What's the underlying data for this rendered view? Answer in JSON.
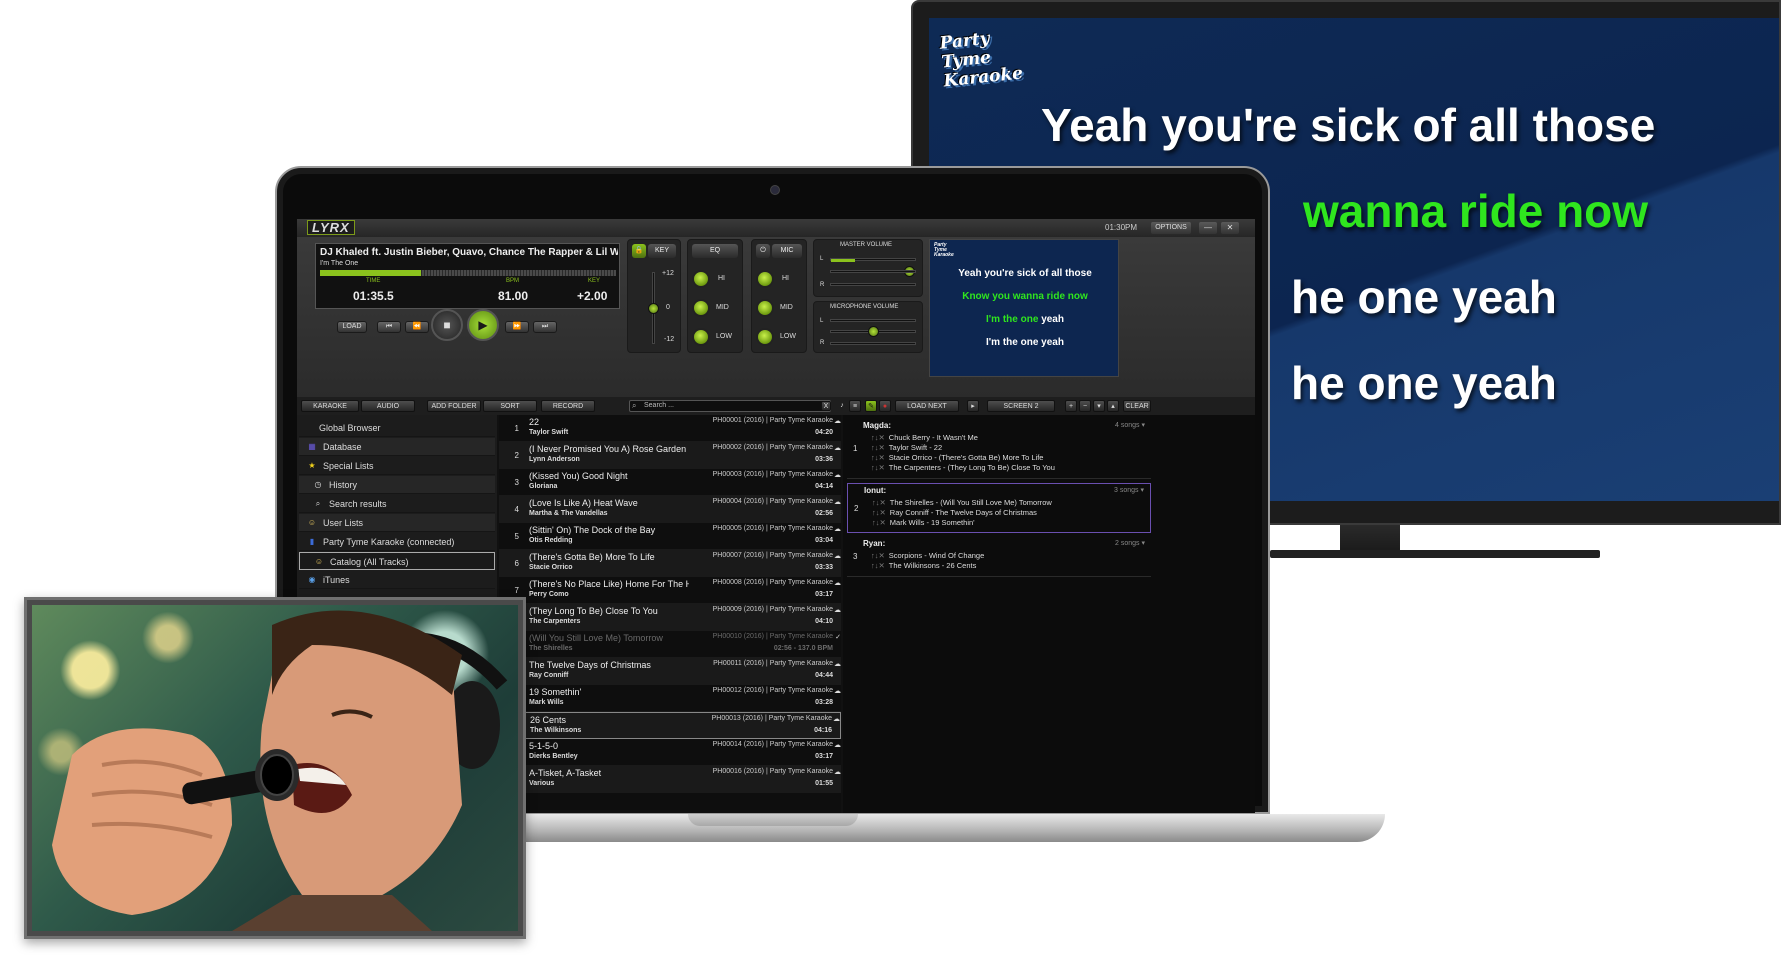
{
  "tv": {
    "logo": "Party Tyme Karaoke",
    "lines": [
      {
        "text": "Yeah you're sick of all those",
        "color": "#ffffff"
      },
      {
        "text": "wanna ride now",
        "color": "#2fe61e"
      },
      {
        "text": "he one yeah",
        "color": "#ffffff"
      },
      {
        "text": "he one yeah",
        "color": "#ffffff"
      }
    ]
  },
  "app": {
    "logo": "LYRX",
    "clock": "01:30PM",
    "options_label": "OPTIONS",
    "window_min": "—",
    "window_close": "✕",
    "now_playing": {
      "title": "DJ Khaled ft. Justin Bieber, Quavo, Chance The Rapper & Lil Wayne",
      "subtitle": "I'm The One",
      "progress": 0.34,
      "time_label": "TIME",
      "time": "01:35.5",
      "bpm_label": "BPM",
      "bpm": "81.00",
      "key_label": "KEY",
      "key": "+2.00"
    },
    "transport": {
      "load": "LOAD",
      "prev_track": "⏮",
      "rewind": "⏪",
      "stop": "■",
      "play": "▶",
      "fast_forward": "⏩",
      "next_track": "⏭"
    },
    "key_panel": {
      "label": "KEY",
      "plus": "+12",
      "zero": "0",
      "minus": "-12",
      "level": 0.5
    },
    "eq": {
      "label": "EQ",
      "hi": "HI",
      "mid": "MID",
      "low": "LOW"
    },
    "mic": {
      "label": "MIC",
      "hi": "HI",
      "mid": "MID",
      "low": "LOW"
    },
    "master_volume": {
      "label": "MASTER VOLUME",
      "l": "L",
      "r": "R",
      "left_level": 0.28,
      "right_level": 0.92
    },
    "mic_volume": {
      "label": "MICROPHONE VOLUME",
      "l": "L",
      "r": "R",
      "left_level": 0.0,
      "right_level": 0.5
    },
    "preview": {
      "logo": "Party Tyme Karaoke",
      "lines": [
        {
          "parts": [
            {
              "text": "Yeah you're sick of all those",
              "color": "#ffffff"
            }
          ]
        },
        {
          "parts": [
            {
              "text": "Know you wanna ride now",
              "color": "#2fe61e"
            }
          ]
        },
        {
          "parts": [
            {
              "text": "I'm the one ",
              "color": "#2fe61e"
            },
            {
              "text": "yeah",
              "color": "#ffffff"
            }
          ]
        },
        {
          "parts": [
            {
              "text": "I'm the one yeah",
              "color": "#ffffff"
            }
          ]
        }
      ]
    },
    "toolbar": {
      "karaoke": "KARAOKE",
      "audio": "AUDIO",
      "add_folder": "ADD FOLDER",
      "sort": "SORT",
      "record": "RECORD",
      "search_placeholder": "Search ...",
      "clear_search": "X",
      "load_next_singer": "LOAD NEXT SINGER",
      "screen": "SCREEN 2",
      "clear": "CLEAR"
    },
    "sidebar": [
      {
        "label": "Global Browser",
        "icon": "",
        "indent": 0
      },
      {
        "label": "Database",
        "icon": "database-icon",
        "indent": 0
      },
      {
        "label": "Special Lists",
        "icon": "star-icon",
        "indent": 0
      },
      {
        "label": "History",
        "icon": "clock-icon",
        "indent": 1
      },
      {
        "label": "Search results",
        "icon": "magnifier-icon",
        "indent": 1
      },
      {
        "label": "User Lists",
        "icon": "user-icon",
        "indent": 0
      },
      {
        "label": "Party Tyme Karaoke (connected)",
        "icon": "party-tyme-icon",
        "indent": 0
      },
      {
        "label": "Catalog (All Tracks)",
        "icon": "catalog-icon",
        "indent": 1
      },
      {
        "label": "iTunes",
        "icon": "itunes-icon",
        "indent": 0
      }
    ],
    "tracks": [
      {
        "num": "1",
        "title": "22",
        "artist": "Taylor Swift",
        "catalog": "PH00001 (2016) | Party Tyme Karaoke",
        "duration": "04:20"
      },
      {
        "num": "2",
        "title": "(I Never Promised You A) Rose Garden",
        "artist": "Lynn Anderson",
        "catalog": "PH00002 (2016) | Party Tyme Karaoke",
        "duration": "03:36"
      },
      {
        "num": "3",
        "title": "(Kissed You) Good Night",
        "artist": "Gloriana",
        "catalog": "PH00003 (2016) | Party Tyme Karaoke",
        "duration": "04:14"
      },
      {
        "num": "4",
        "title": "(Love Is Like A) Heat Wave",
        "artist": "Martha & The Vandellas",
        "catalog": "PH00004 (2016) | Party Tyme Karaoke",
        "duration": "02:56"
      },
      {
        "num": "5",
        "title": "(Sittin' On) The Dock of the Bay",
        "artist": "Otis Redding",
        "catalog": "PH00005 (2016) | Party Tyme Karaoke",
        "duration": "03:04"
      },
      {
        "num": "6",
        "title": "(There's Gotta Be) More To Life",
        "artist": "Stacie Orrico",
        "catalog": "PH00007 (2016) | Party Tyme Karaoke",
        "duration": "03:33"
      },
      {
        "num": "7",
        "title": "(There's No Place Like) Home For The Holidays",
        "artist": "Perry Como",
        "catalog": "PH00008 (2016) | Party Tyme Karaoke",
        "duration": "03:17"
      },
      {
        "num": "8",
        "title": "(They Long To Be) Close To You",
        "artist": "The Carpenters",
        "catalog": "PH00009 (2016) | Party Tyme Karaoke",
        "duration": "04:10"
      },
      {
        "num": "9",
        "title": "(Will You Still Love Me) Tomorrow",
        "artist": "The Shirelles",
        "catalog": "PH00010 (2016) | Party Tyme Karaoke",
        "duration": "02:56 - 137.0 BPM",
        "played": true
      },
      {
        "num": "10",
        "title": "The Twelve Days of Christmas",
        "artist": "Ray Conniff",
        "catalog": "PH00011 (2016) | Party Tyme Karaoke",
        "duration": "04:44"
      },
      {
        "num": "11",
        "title": "19 Somethin'",
        "artist": "Mark Wills",
        "catalog": "PH00012 (2016) | Party Tyme Karaoke",
        "duration": "03:28"
      },
      {
        "num": "12",
        "title": "26 Cents",
        "artist": "The Wilkinsons",
        "catalog": "PH00013 (2016) | Party Tyme Karaoke",
        "duration": "04:16",
        "selected": true
      },
      {
        "num": "13",
        "title": "5-1-5-0",
        "artist": "Dierks Bentley",
        "catalog": "PH00014 (2016) | Party Tyme Karaoke",
        "duration": "03:17"
      },
      {
        "num": "14",
        "title": "A-Tisket, A-Tasket",
        "artist": "Various",
        "catalog": "PH00016 (2016) | Party Tyme Karaoke",
        "duration": "01:55"
      }
    ],
    "singers": [
      {
        "index": "1",
        "name": "Magda:",
        "count": "4 songs",
        "songs": [
          "Chuck Berry - It Wasn't Me",
          "Taylor Swift - 22",
          "Stacie Orrico - (There's Gotta Be) More To Life",
          "The Carpenters - (They Long To Be) Close To You"
        ]
      },
      {
        "index": "2",
        "name": "Ionut:",
        "count": "3 songs",
        "songs": [
          "The Shirelles - (Will You Still Love Me) Tomorrow",
          "Ray Conniff - The Twelve Days of Christmas",
          "Mark Wills - 19 Somethin'"
        ],
        "selected": true
      },
      {
        "index": "3",
        "name": "Ryan:",
        "count": "2 songs",
        "songs": [
          "Scorpions - Wind Of Change",
          "The Wilkinsons - 26 Cents"
        ]
      }
    ]
  },
  "colors": {
    "accent": "#8bc21d",
    "karaoke_green": "#2fe61e",
    "tv_blue": "#0e2a55"
  }
}
